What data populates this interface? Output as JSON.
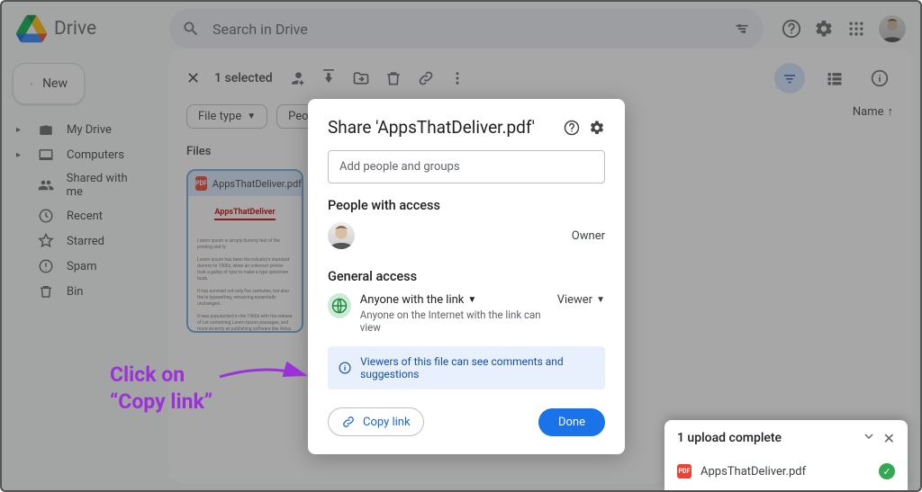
{
  "app": {
    "name": "Drive"
  },
  "search": {
    "placeholder": "Search in Drive"
  },
  "new_button": "New",
  "sidebar": {
    "items": [
      {
        "label": "My Drive"
      },
      {
        "label": "Computers"
      },
      {
        "label": "Shared with me"
      },
      {
        "label": "Recent"
      },
      {
        "label": "Starred"
      },
      {
        "label": "Spam"
      },
      {
        "label": "Bin"
      }
    ]
  },
  "selection_bar": {
    "count_label": "1 selected"
  },
  "filters": {
    "file_type": "File type",
    "people": "People"
  },
  "files_section": {
    "heading": "Files",
    "sort_label": "Name"
  },
  "file_card": {
    "name": "AppsThatDeliver.pdf",
    "thumb_title": "AppsThatDeliver"
  },
  "modal": {
    "title": "Share 'AppsThatDeliver.pdf'",
    "add_placeholder": "Add people and groups",
    "people_access": "People with access",
    "owner_role": "Owner",
    "general_access": "General access",
    "link_scope": "Anyone with the link",
    "link_scope_sub": "Anyone on the Internet with the link can view",
    "role": "Viewer",
    "info": "Viewers of this file can see comments and suggestions",
    "copy_link": "Copy link",
    "done": "Done"
  },
  "annotation": {
    "line1": "Click on",
    "line2": "“Copy link”"
  },
  "toast": {
    "title": "1 upload complete",
    "file": "AppsThatDeliver.pdf"
  }
}
